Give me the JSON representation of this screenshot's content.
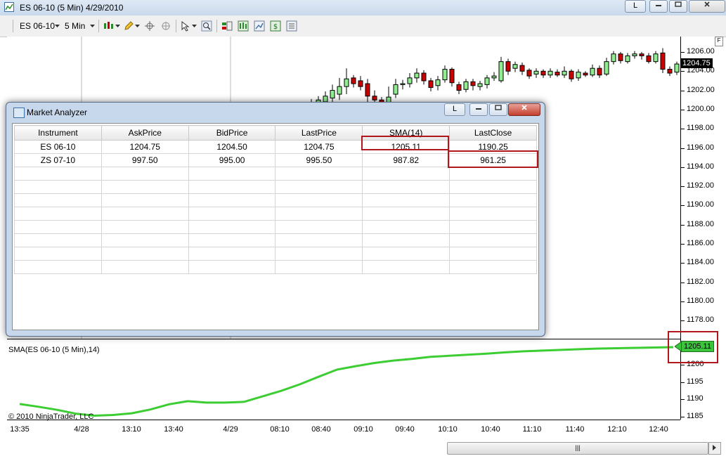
{
  "window": {
    "title": "ES 06-10 (5 Min)  4/29/2010",
    "btn_l": "L"
  },
  "toolbar": {
    "instrument": "ES 06-10",
    "interval": "5 Min"
  },
  "price_axis": [
    "1206.00",
    "1204.00",
    "1202.00",
    "1200.00",
    "1198.00",
    "1196.00",
    "1194.00",
    "1192.00",
    "1190.00",
    "1188.00",
    "1186.00",
    "1184.00",
    "1182.00",
    "1180.00",
    "1178.00"
  ],
  "last_price_label": "1204.75",
  "indicator": {
    "label": "SMA(ES 06-10 (5 Min),14)",
    "value_label": "1205.11",
    "axis": [
      "1200",
      "1195",
      "1190",
      "1185"
    ]
  },
  "copyright": "© 2010 NinjaTrader, LLC",
  "time_axis": [
    "13:35",
    "4/28",
    "13:10",
    "13:40",
    "4/29",
    "08:10",
    "08:40",
    "09:10",
    "09:40",
    "10:10",
    "10:40",
    "11:10",
    "11:40",
    "12:10",
    "12:40"
  ],
  "market_analyzer": {
    "title": "Market Analyzer",
    "btn_l": "L",
    "columns": [
      "Instrument",
      "AskPrice",
      "BidPrice",
      "LastPrice",
      "SMA(14)",
      "LastClose"
    ],
    "rows": [
      [
        "ES 06-10",
        "1204.75",
        "1204.50",
        "1204.75",
        "1205.11",
        "1190.25"
      ],
      [
        "ZS 07-10",
        "997.50",
        "995.00",
        "995.50",
        "987.82",
        "961.25"
      ],
      [
        "",
        "",
        "",
        "",
        "",
        ""
      ],
      [
        "",
        "",
        "",
        "",
        "",
        ""
      ],
      [
        "",
        "",
        "",
        "",
        "",
        ""
      ],
      [
        "",
        "",
        "",
        "",
        "",
        ""
      ],
      [
        "",
        "",
        "",
        "",
        "",
        ""
      ],
      [
        "",
        "",
        "",
        "",
        "",
        ""
      ],
      [
        "",
        "",
        "",
        "",
        "",
        ""
      ],
      [
        "",
        "",
        "",
        "",
        "",
        ""
      ]
    ]
  },
  "colors": {
    "up": "#90ee90",
    "down": "#cc0000",
    "sma": "#3ccd32",
    "highlight": "#b0171c"
  }
}
